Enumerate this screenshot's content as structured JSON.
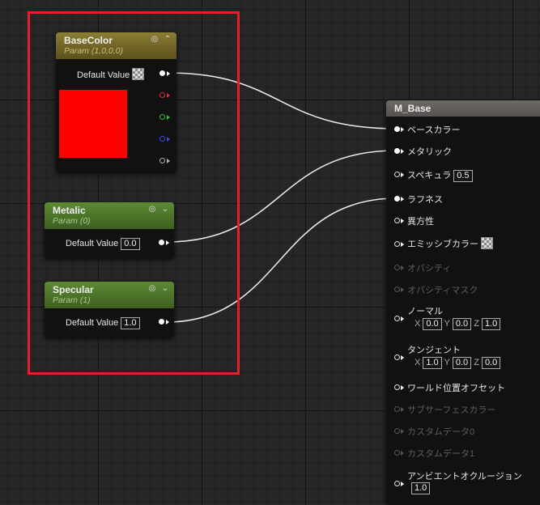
{
  "nodes": {
    "basecolor": {
      "title": "BaseColor",
      "subtitle": "Param (1,0,0,0)",
      "default_label": "Default Value",
      "preview_color": "#ff0000"
    },
    "metalic": {
      "title": "Metalic",
      "subtitle": "Param (0)",
      "default_label": "Default Value",
      "default_value": "0.0"
    },
    "specular": {
      "title": "Specular",
      "subtitle": "Param (1)",
      "default_label": "Default Value",
      "default_value": "1.0"
    },
    "m_base": {
      "title": "M_Base",
      "inputs": {
        "base_color": "ベースカラー",
        "metallic": "メタリック",
        "specular": "スペキュラ",
        "specular_value": "0.5",
        "roughness": "ラフネス",
        "anisotropy": "異方性",
        "emissive": "エミッシブカラー",
        "opacity": "オパシティ",
        "opacity_mask": "オパシティマスク",
        "normal": "ノーマル",
        "tangent": "タンジェント",
        "wpo": "ワールド位置オフセット",
        "subsurface": "サブサーフェスカラー",
        "custom0": "カスタムデータ0",
        "custom1": "カスタムデータ1",
        "ao": "アンビエントオクルージョン",
        "ao_value": "1.0"
      },
      "normal_vec": {
        "x_label": "X",
        "y_label": "Y",
        "z_label": "Z",
        "x": "0.0",
        "y": "0.0",
        "z": "1.0"
      },
      "tangent_vec": {
        "x_label": "X",
        "y_label": "Y",
        "z_label": "Z",
        "x": "1.0",
        "y": "0.0",
        "z": "0.0"
      }
    }
  },
  "colors": {
    "selection": "#e0202a",
    "wire": "#e8e8e8",
    "pin_red": "#e03030",
    "pin_green": "#30c030",
    "pin_blue": "#3050e0",
    "pin_alpha": "#b0b0b0"
  },
  "icons": {
    "expand": "circle-arrow-icon",
    "collapse_up": "chevron-up-icon",
    "collapse_down": "chevron-down-icon",
    "checker": "checker-texture-icon"
  }
}
